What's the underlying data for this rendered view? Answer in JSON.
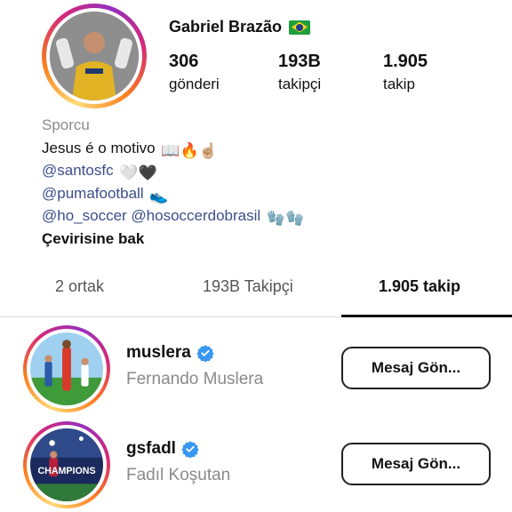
{
  "profile": {
    "username": "Gabriel Brazão",
    "flag_icon": "brazil-flag-icon",
    "stats": [
      {
        "value": "306",
        "label": "gönderi"
      },
      {
        "value": "193B",
        "label": "takipçi"
      },
      {
        "value": "1.905",
        "label": "takip"
      }
    ],
    "bio": {
      "category": "Sporcu",
      "line1": "Jesus é o motivo",
      "line1_emoji": "📖🔥☝🏼",
      "link1": "@santosfc",
      "link1_emoji": "🤍🖤",
      "link2": "@pumafootball",
      "link2_emoji": "👟",
      "link3": "@ho_soccer @hosoccerdobrasil",
      "link3_emoji": "🧤🧤",
      "translate": "Çevirisine bak"
    }
  },
  "tabs": [
    {
      "label": "2 ortak",
      "active": false
    },
    {
      "label": "193B Takipçi",
      "active": false
    },
    {
      "label": "1.905 takip",
      "active": true
    }
  ],
  "following": [
    {
      "username": "muslera",
      "full_name": "Fernando Muslera",
      "verified": true,
      "button": "Mesaj Gön..."
    },
    {
      "username": "gsfadl",
      "full_name": "Fadıl Koşutan",
      "verified": true,
      "button": "Mesaj Gön...",
      "avatar_text": "CHAMPIONS"
    }
  ],
  "colors": {
    "link": "#3b4e8c",
    "verified": "#3897f0",
    "muted": "#8a8a8a"
  }
}
